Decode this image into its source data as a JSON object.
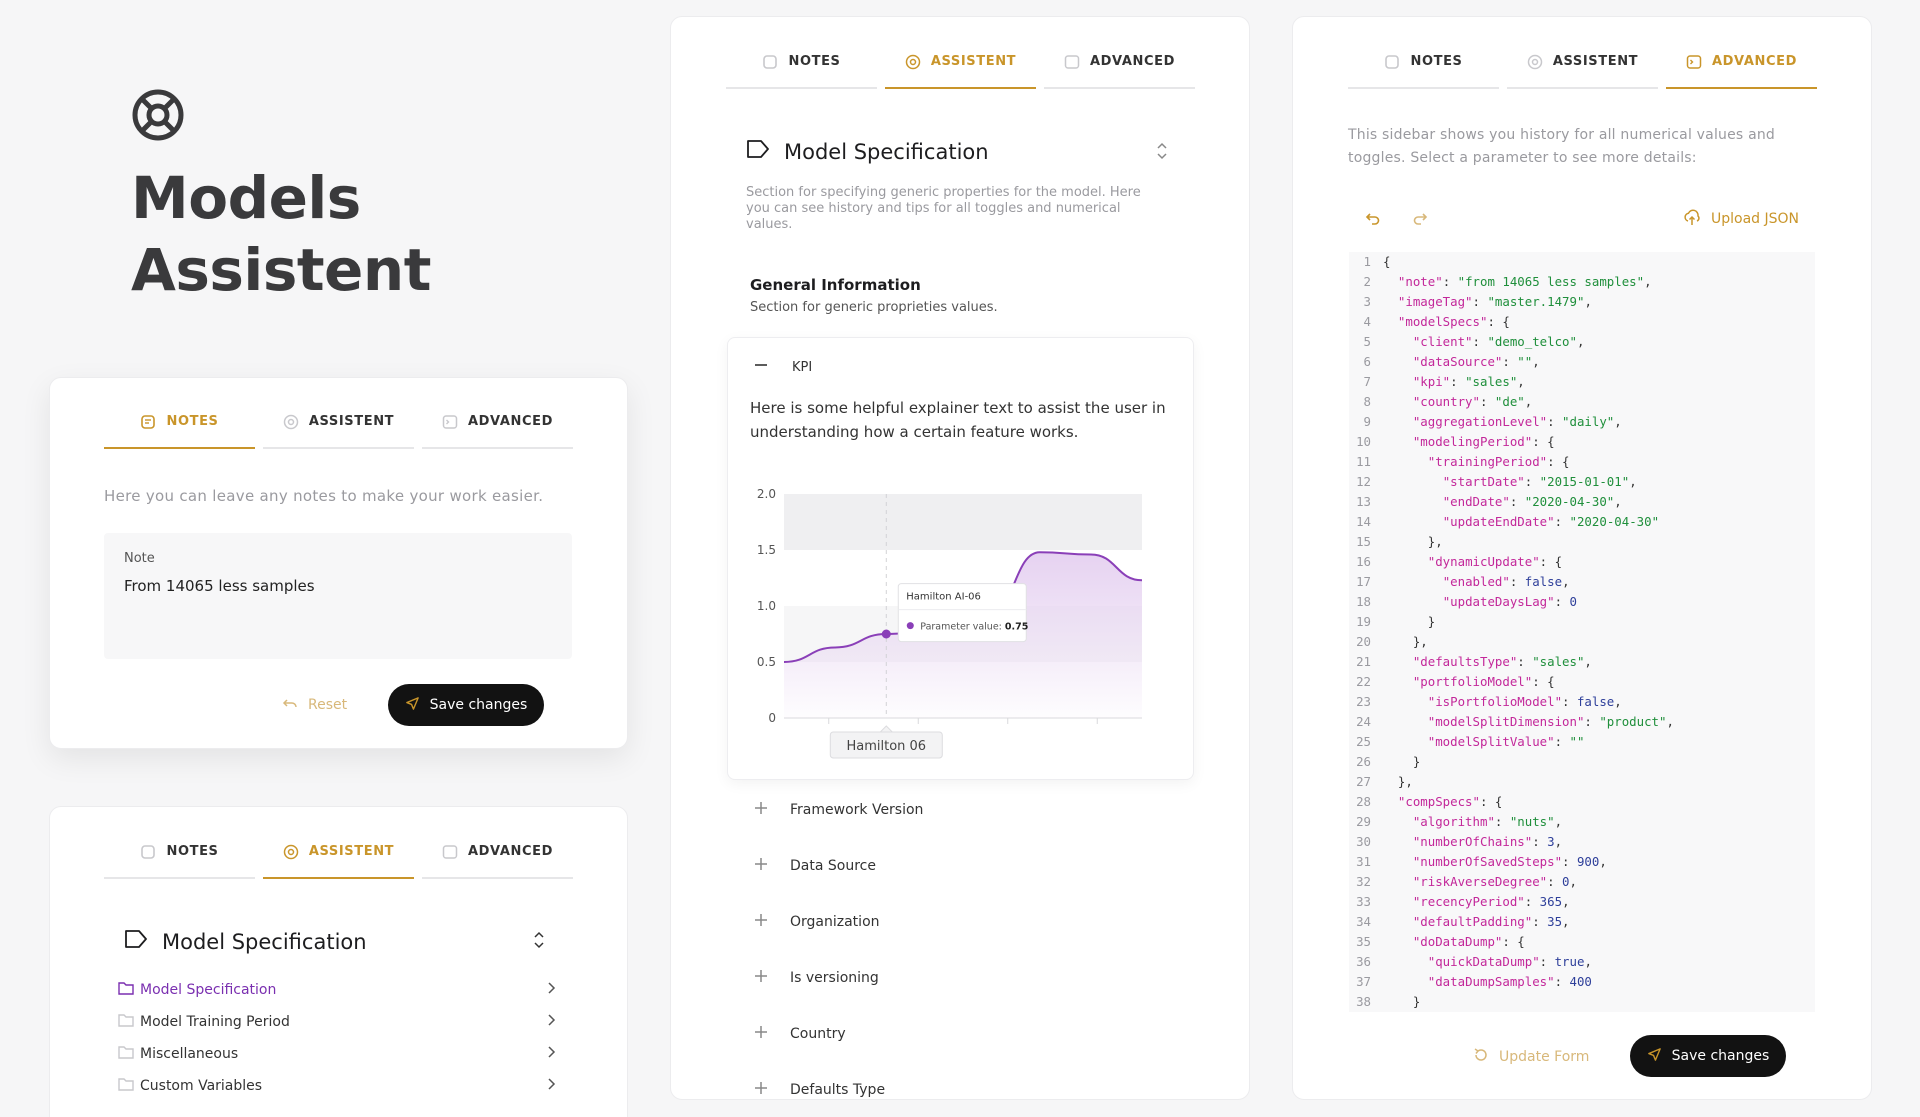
{
  "hero": {
    "title_line1": "Models",
    "title_line2": "Assistent"
  },
  "tabs": {
    "notes": "NOTES",
    "assistent": "ASSISTENT",
    "advanced": "ADVANCED"
  },
  "notes_panel": {
    "description": "Here you can leave any notes to make your work easier.",
    "note_label": "Note",
    "note_value": "From 14065 less samples",
    "reset_label": "Reset",
    "save_label": "Save changes"
  },
  "tree_panel": {
    "section_title": "Model Specification",
    "items": [
      {
        "label": "Model Specification",
        "active": true
      },
      {
        "label": "Model Training Period",
        "active": false
      },
      {
        "label": "Miscellaneous",
        "active": false
      },
      {
        "label": "Custom Variables",
        "active": false
      }
    ]
  },
  "assistent_panel": {
    "section_title": "Model Specification",
    "section_desc": "Section for specifying generic properties for the model. Here you can see history and tips for all toggles and numerical values.",
    "group_title": "General Information",
    "group_desc": "Section for generic proprieties values.",
    "kpi_title": "KPI",
    "kpi_help": "Here is some helpful explainer text to assist the user in understanding how a certain feature works.",
    "accordion": [
      "Framework Version",
      "Data Source",
      "Organization",
      "Is versioning",
      "Country",
      "Defaults Type"
    ]
  },
  "chart_data": {
    "type": "area",
    "ylim": [
      0,
      2.0
    ],
    "yticks": [
      "0",
      "0.5",
      "1.0",
      "1.5",
      "2.0"
    ],
    "x": [
      0,
      1,
      2,
      3,
      4,
      5,
      6,
      7
    ],
    "values": [
      0.5,
      0.63,
      0.75,
      0.78,
      0.92,
      1.48,
      1.46,
      1.23
    ],
    "tooltip": {
      "title": "Hamilton AI-06",
      "label": "Parameter value:",
      "value": "0.75"
    },
    "x_marker_label": "Hamilton 06",
    "colors": {
      "line": "#8a3fb8",
      "fill": "#e6d2f1"
    }
  },
  "advanced_panel": {
    "description": "This sidebar shows you history for all numerical values and toggles. Select a parameter to see more details:",
    "upload_label": "Upload JSON",
    "update_label": "Update Form",
    "save_label": "Save changes",
    "code_lines": [
      "{",
      "  \"note\": \"from 14065 less samples\",",
      "  \"imageTag\": \"master.1479\",",
      "  \"modelSpecs\": {",
      "    \"client\": \"demo_telco\",",
      "    \"dataSource\": \"\",",
      "    \"kpi\": \"sales\",",
      "    \"country\": \"de\",",
      "    \"aggregationLevel\": \"daily\",",
      "    \"modelingPeriod\": {",
      "      \"trainingPeriod\": {",
      "        \"startDate\": \"2015-01-01\",",
      "        \"endDate\": \"2020-04-30\",",
      "        \"updateEndDate\": \"2020-04-30\"",
      "      },",
      "      \"dynamicUpdate\": {",
      "        \"enabled\": false,",
      "        \"updateDaysLag\": 0",
      "      }",
      "    },",
      "    \"defaultsType\": \"sales\",",
      "    \"portfolioModel\": {",
      "      \"isPortfolioModel\": false,",
      "      \"modelSplitDimension\": \"product\",",
      "      \"modelSplitValue\": \"\"",
      "    }",
      "  },",
      "  \"compSpecs\": {",
      "    \"algorithm\": \"nuts\",",
      "    \"numberOfChains\": 3,",
      "    \"numberOfSavedSteps\": 900,",
      "    \"riskAverseDegree\": 0,",
      "    \"recencyPeriod\": 365,",
      "    \"defaultPadding\": 35,",
      "    \"doDataDump\": {",
      "      \"quickDataDump\": true,",
      "      \"dataDumpSamples\": 400",
      "    }"
    ]
  }
}
